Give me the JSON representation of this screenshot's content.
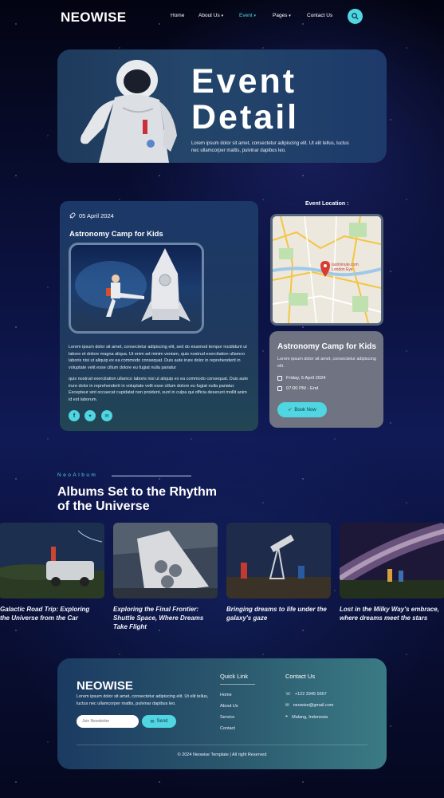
{
  "nav": {
    "logo": "NEOWISE",
    "items": [
      {
        "label": "Home"
      },
      {
        "label": "About Us"
      },
      {
        "label": "Event"
      },
      {
        "label": "Pages"
      },
      {
        "label": "Contact Us"
      }
    ],
    "accent": "#4fd6e0"
  },
  "hero": {
    "title_line1": "Event",
    "title_line2": "Detail",
    "text": "Lorem ipsum dolor sit amet, consectetur adipiscing elit. Ut elit tellus, luctus nec ullamcorper mattis, pulvinar dapibus leo."
  },
  "event": {
    "date": "05 April 2024",
    "title": "Astronomy Camp for Kids",
    "para1": "Lorem ipsum dolor sit amet, consectetur adipiscing elit, sed do eiusmod tempor incididunt ut labore et dolore magna aliqua. Ut enim ad minim veniam, quis nostrud exercitation ullamco laboris nisi ut aliquip ex ea commodo consequat. Duis aute irure dolor in reprehenderit in voluptate velit esse cillum dolore eu fugiat nulla pariatur",
    "para2": "quis nostrud exercitation ullamco laboris nisi ut aliquip ex ea commodo consequat. Duis aute irure dolor in reprehenderit in voluptate velit esse cillum dolore eu fugiat nulla pariatur. Excepteur sint occaecat cupidatat non proident, sunt in culpa qui officia deserunt mollit anim id est laborum."
  },
  "location": {
    "label": "Event Location :",
    "map_pin": "lastminute.com London Eye"
  },
  "info_card": {
    "title": "Astronomy Camp for Kids",
    "text": "Lorem ipsum dolor sit amet, consectetur adipiscing elit.",
    "date": "Friday, 5 April 2024",
    "time": "07:00 PM - End",
    "button": "Book Now"
  },
  "albums": {
    "eyebrow": "NeoAlbum",
    "heading_line1": "Albums Set to the Rhythm",
    "heading_line2": "of the Universe",
    "items": [
      {
        "caption": "Galactic Road Trip: Exploring the Universe from the Car"
      },
      {
        "caption": "Exploring the Final Frontier: Shuttle Space, Where Dreams Take Flight"
      },
      {
        "caption": "Bringing dreams to life under the galaxy's gaze"
      },
      {
        "caption": "Lost in the Milky Way's embrace, where dreams meet the stars"
      }
    ]
  },
  "footer": {
    "logo": "NEOWISE",
    "text": "Lorem ipsum dolor sit amet, consectetur adipiscing elit. Ut elit tellus, luctus nec ullamcorper mattis, pulvinar dapibus leo.",
    "newsletter_placeholder": "Join Newsletter",
    "send": "Send",
    "quick_link_title": "Quick Link",
    "quick_links": [
      {
        "label": "Home"
      },
      {
        "label": "About Us"
      },
      {
        "label": "Service"
      },
      {
        "label": "Contact"
      }
    ],
    "contact_title": "Contact Us",
    "phone": "+122 3345 5567",
    "email": "neowise@gmail.com",
    "address": "Malang, Indonesia",
    "copyright": "© 2024 Neowise Template | All right Reserved"
  }
}
